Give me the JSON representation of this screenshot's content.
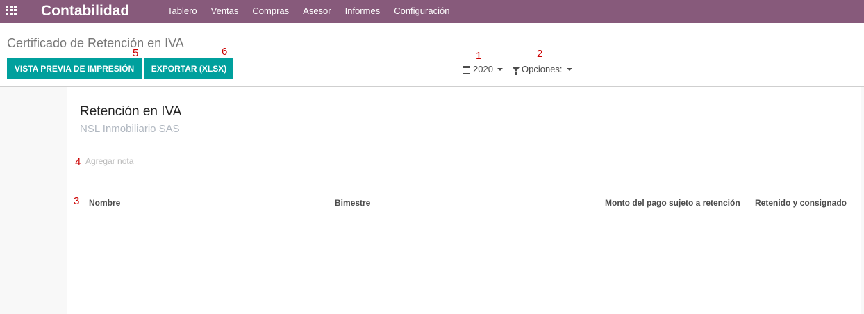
{
  "navbar": {
    "app_title": "Contabilidad",
    "menu": [
      "Tablero",
      "Ventas",
      "Compras",
      "Asesor",
      "Informes",
      "Configuración"
    ]
  },
  "control_panel": {
    "breadcrumb": "Certificado de Retención en IVA",
    "buttons": {
      "print_preview": "VISTA PREVIA DE IMPRESIÓN",
      "export": "EXPORTAR (XLSX)"
    },
    "filters": {
      "year": "2020",
      "options": "Opciones:"
    }
  },
  "report": {
    "title": "Retención en IVA",
    "company": "NSL Inmobiliario SAS",
    "note_placeholder": "Agregar nota",
    "columns": [
      "Nombre",
      "Bimestre",
      "Monto del pago sujeto a retención",
      "Retenido y consignado"
    ]
  },
  "annotations": [
    "1",
    "2",
    "3",
    "4",
    "5",
    "6"
  ],
  "colors": {
    "navbar": "#875a7b",
    "button": "#00a09d",
    "annotation": "#cc0000"
  }
}
